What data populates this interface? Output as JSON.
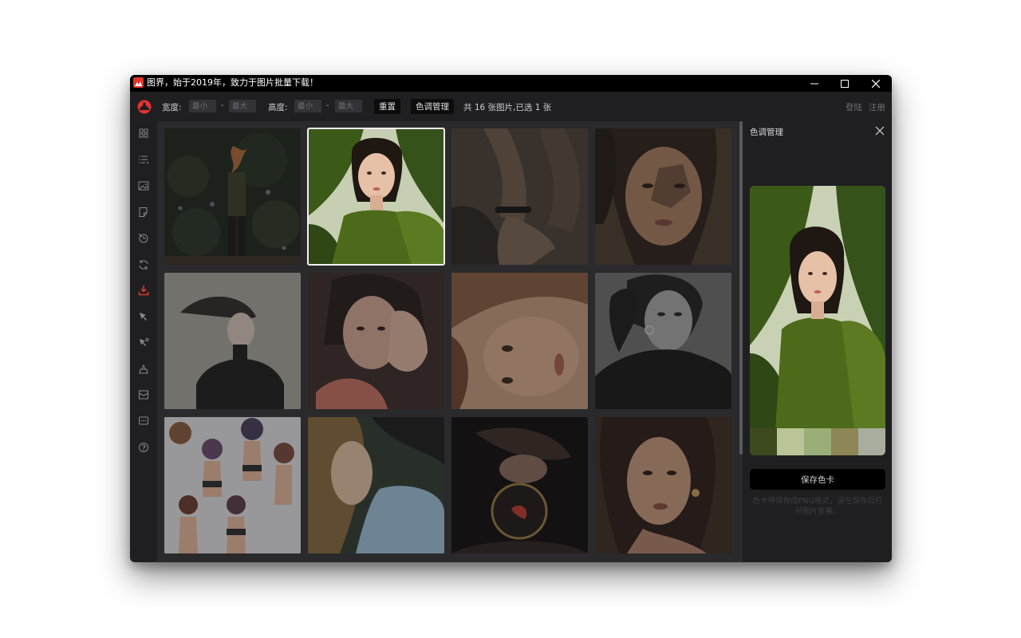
{
  "window": {
    "title": "图界，始于2019年，致力于图片批量下载！"
  },
  "toolbar": {
    "width_label": "宽度:",
    "height_label": "高度:",
    "min_placeholder": "最小",
    "max_placeholder": "最大",
    "dash": "-",
    "reset_label": "重置",
    "color_label": "色调管理",
    "count_text": "共 16 张图片,已选 1 张",
    "login_label": "登陆",
    "register_label": "注册"
  },
  "sidebar": {
    "items": [
      {
        "icon": "grid-icon"
      },
      {
        "icon": "list-sort-icon"
      },
      {
        "icon": "image-icon"
      },
      {
        "icon": "note-icon"
      },
      {
        "icon": "tag-icon"
      },
      {
        "icon": "refresh-icon"
      },
      {
        "icon": "download-icon",
        "active": true
      },
      {
        "icon": "cursor-icon"
      },
      {
        "icon": "cursor-settings-icon"
      },
      {
        "icon": "clean-icon"
      },
      {
        "icon": "mail-icon"
      },
      {
        "icon": "chat-icon"
      },
      {
        "icon": "help-icon"
      }
    ]
  },
  "gallery": {
    "images": [
      {
        "name": "flowers-fire",
        "selected": false
      },
      {
        "name": "monstera-girl",
        "selected": true
      },
      {
        "name": "hands-bracelet",
        "selected": false
      },
      {
        "name": "shadow-face",
        "selected": false
      },
      {
        "name": "wind-hair",
        "selected": false
      },
      {
        "name": "hand-face",
        "selected": false
      },
      {
        "name": "curly-hair",
        "selected": false
      },
      {
        "name": "bw-portrait",
        "selected": false
      },
      {
        "name": "anime-figures",
        "selected": false
      },
      {
        "name": "profile-light",
        "selected": false
      },
      {
        "name": "goldfish-bowl",
        "selected": false
      },
      {
        "name": "earrings-portrait",
        "selected": false
      }
    ]
  },
  "panel": {
    "title": "色调管理",
    "palette": [
      "#3d4a1f",
      "#bac697",
      "#9aaf77",
      "#8d8657",
      "#a9ad9d"
    ],
    "save_label": "保存色卡",
    "hint": "色卡将保存成PNG格式，请在保存后打开图片查看。"
  },
  "colors": {
    "accent": "#e2332c",
    "window_bg": "#1f1f22",
    "titlebar": "#000000"
  }
}
